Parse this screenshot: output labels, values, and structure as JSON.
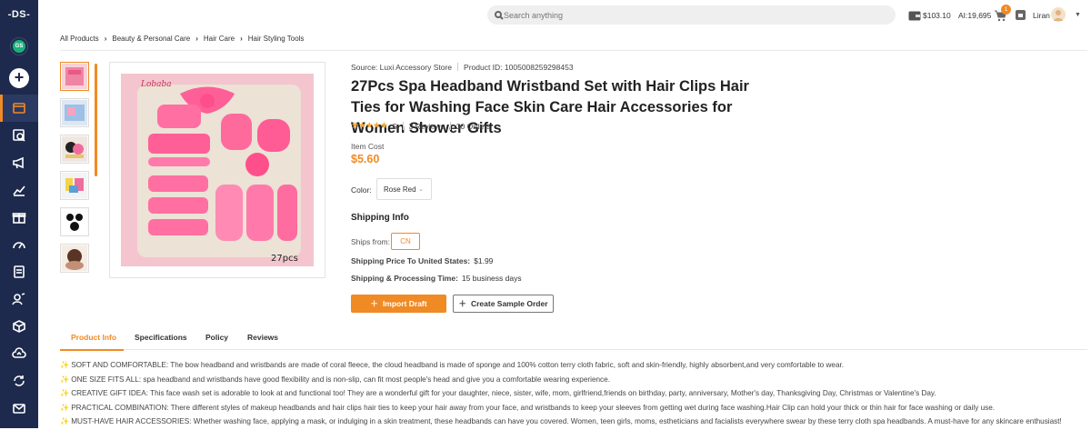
{
  "sidebar": {
    "logo": "-DS-",
    "workspace": "GS",
    "add_label": "+",
    "items": [
      {
        "icon": "box-icon",
        "active": true
      },
      {
        "icon": "find-products-icon"
      },
      {
        "icon": "megaphone-icon"
      },
      {
        "icon": "chart-icon"
      },
      {
        "icon": "gift-icon"
      },
      {
        "icon": "gauge-icon"
      },
      {
        "icon": "orders-doc-icon"
      },
      {
        "icon": "people-icon"
      },
      {
        "icon": "package-icon"
      },
      {
        "icon": "cloud-upload-icon"
      },
      {
        "icon": "sync-icon"
      },
      {
        "icon": "mail-icon"
      }
    ]
  },
  "topbar": {
    "search_placeholder": "Search anything",
    "balance": "$103.10",
    "ai_credits": "AI:19,695",
    "cart_count": "1",
    "user_name": "Liran"
  },
  "breadcrumb": [
    "All Products",
    "Beauty & Personal Care",
    "Hair Care",
    "Hair Styling Tools"
  ],
  "product": {
    "source_label": "Source: Luxi Accessory Store",
    "product_id": "Product ID: 1005008259298453",
    "title": "27Pcs Spa Headband Wristband Set with Hair Clips Hair Ties for Washing Face Skin Care Hair Accessories for Women Shower Gifts",
    "stars": "★★★★★",
    "rating": "5",
    "reviews": "3 Reviews",
    "orders": "30 Orders",
    "item_cost_label": "Item Cost",
    "item_cost": "$5.60",
    "color_label": "Color:",
    "color_value": "Rose Red",
    "image_brand": "Lobaba",
    "image_caption": "27pcs"
  },
  "shipping": {
    "title": "Shipping Info",
    "ships_from_label": "Ships from:",
    "ships_from_value": "CN",
    "price_label": "Shipping Price To United States:",
    "price_value": "$1.99",
    "time_label": "Shipping & Processing Time:",
    "time_value": "15 business days"
  },
  "actions": {
    "import_draft": "Import Draft",
    "create_sample": "Create Sample Order"
  },
  "tabs": [
    "Product Info",
    "Specifications",
    "Policy",
    "Reviews"
  ],
  "description": [
    "SOFT AND COMFORTABLE: The bow headband and wristbands are made of coral fleece, the cloud headband is made of sponge and 100% cotton terry cloth fabric, soft and skin-friendly, highly absorbent,and very comfortable to wear.",
    "ONE SIZE FITS ALL: spa headband and wristbands have good flexibility and is non-slip, can fit most people's head and give you a comfortable wearing experience.",
    "CREATIVE GIFT IDEA: This face wash set is adorable to look at and functional too! They are a wonderful gift for your daughter, niece, sister, wife, mom, girlfriend,friends on birthday, party, anniversary, Mother's day, Thanksgiving Day, Christmas or Valentine's Day.",
    "PRACTICAL COMBINATION: There different styles of makeup headbands and hair clips hair ties to keep your hair away from your face, and wristbands to keep your sleeves from getting wet during face washing.Hair Clip can hold your thick or thin hair for face washing or daily use.",
    "MUST-HAVE HAIR ACCESSORIES: Whether washing face, applying a mask, or indulging in a skin treatment, these headbands can have you covered. Women, teen girls, moms, estheticians and facialists everywhere swear by these terry cloth spa headbands. A must-have for any skincare enthusiast!"
  ],
  "colors": {
    "accent": "#f08a24",
    "sidebar": "#1d2a4d",
    "star": "#f0a93a"
  }
}
